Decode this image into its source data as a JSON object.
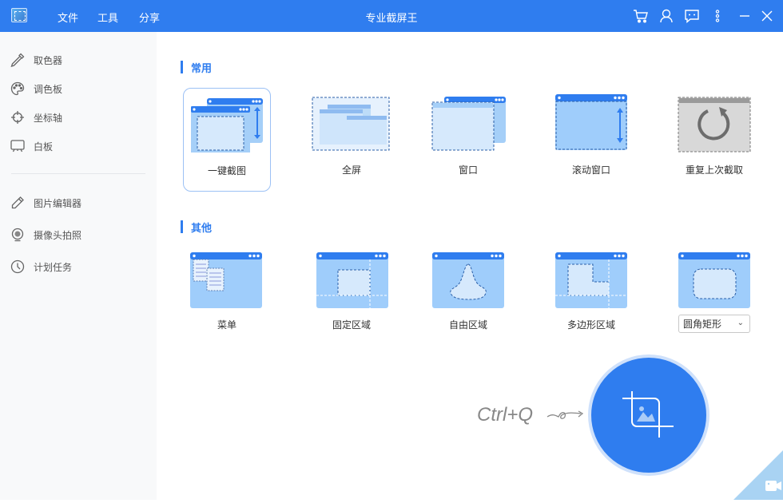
{
  "titlebar": {
    "title": "专业截屏王",
    "menus": [
      "文件",
      "工具",
      "分享"
    ],
    "icons": [
      "cart-icon",
      "user-icon",
      "message-icon",
      "more-icon",
      "minimize-icon",
      "close-icon"
    ]
  },
  "sidebar": {
    "group1": [
      {
        "label": "取色器",
        "icon": "eyedropper-icon"
      },
      {
        "label": "调色板",
        "icon": "palette-icon"
      },
      {
        "label": "坐标轴",
        "icon": "crosshair-icon"
      },
      {
        "label": "白板",
        "icon": "whiteboard-icon"
      }
    ],
    "group2": [
      {
        "label": "图片编辑器",
        "icon": "pencil-icon"
      },
      {
        "label": "摄像头拍照",
        "icon": "webcam-icon"
      },
      {
        "label": "计划任务",
        "icon": "clock-icon"
      }
    ]
  },
  "sections": {
    "common": {
      "title": "常用",
      "items": [
        "一键截图",
        "全屏",
        "窗口",
        "滚动窗口",
        "重复上次截取"
      ]
    },
    "other": {
      "title": "其他",
      "items": [
        "菜单",
        "固定区域",
        "自由区域",
        "多边形区域"
      ],
      "dropdown_value": "圆角矩形"
    }
  },
  "capture": {
    "hotkey": "Ctrl+Q"
  },
  "colors": {
    "accent": "#2f7def",
    "sidebar_bg": "#f8f9fa"
  }
}
